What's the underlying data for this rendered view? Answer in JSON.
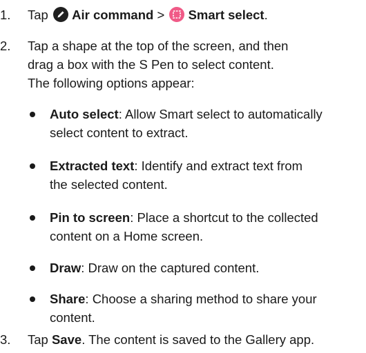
{
  "steps": [
    {
      "number": "1.",
      "tap": "Tap",
      "air_command": "Air command",
      "separator": ">",
      "smart_select": "Smart select",
      "end": "."
    },
    {
      "number": "2.",
      "line1": "Tap a shape at the top of the screen, and then",
      "line2": "drag a box with the S Pen to select content.",
      "line3": "The following options appear:"
    },
    {
      "number": "3.",
      "tap": "Tap",
      "save": "Save",
      "rest": ". The content is saved to the Gallery app."
    }
  ],
  "options": [
    {
      "term": "Auto select",
      "desc_l1": ": Allow Smart select to automatically",
      "desc_l2": "select content to extract."
    },
    {
      "term": "Extracted text",
      "desc_l1": ": Identify and extract text from",
      "desc_l2": "the selected content."
    },
    {
      "term": "Pin to screen",
      "desc_l1": ": Place a shortcut to the collected",
      "desc_l2": "content on a Home screen."
    },
    {
      "term": "Draw",
      "desc_l1": ": Draw on the captured content."
    },
    {
      "term": "Share",
      "desc_l1": ": Choose a sharing method to share your",
      "desc_l2": "content."
    }
  ],
  "icons": {
    "air_command": "pen-icon",
    "smart_select": "smart-select-icon",
    "smart_select_color": "#f05a87"
  }
}
